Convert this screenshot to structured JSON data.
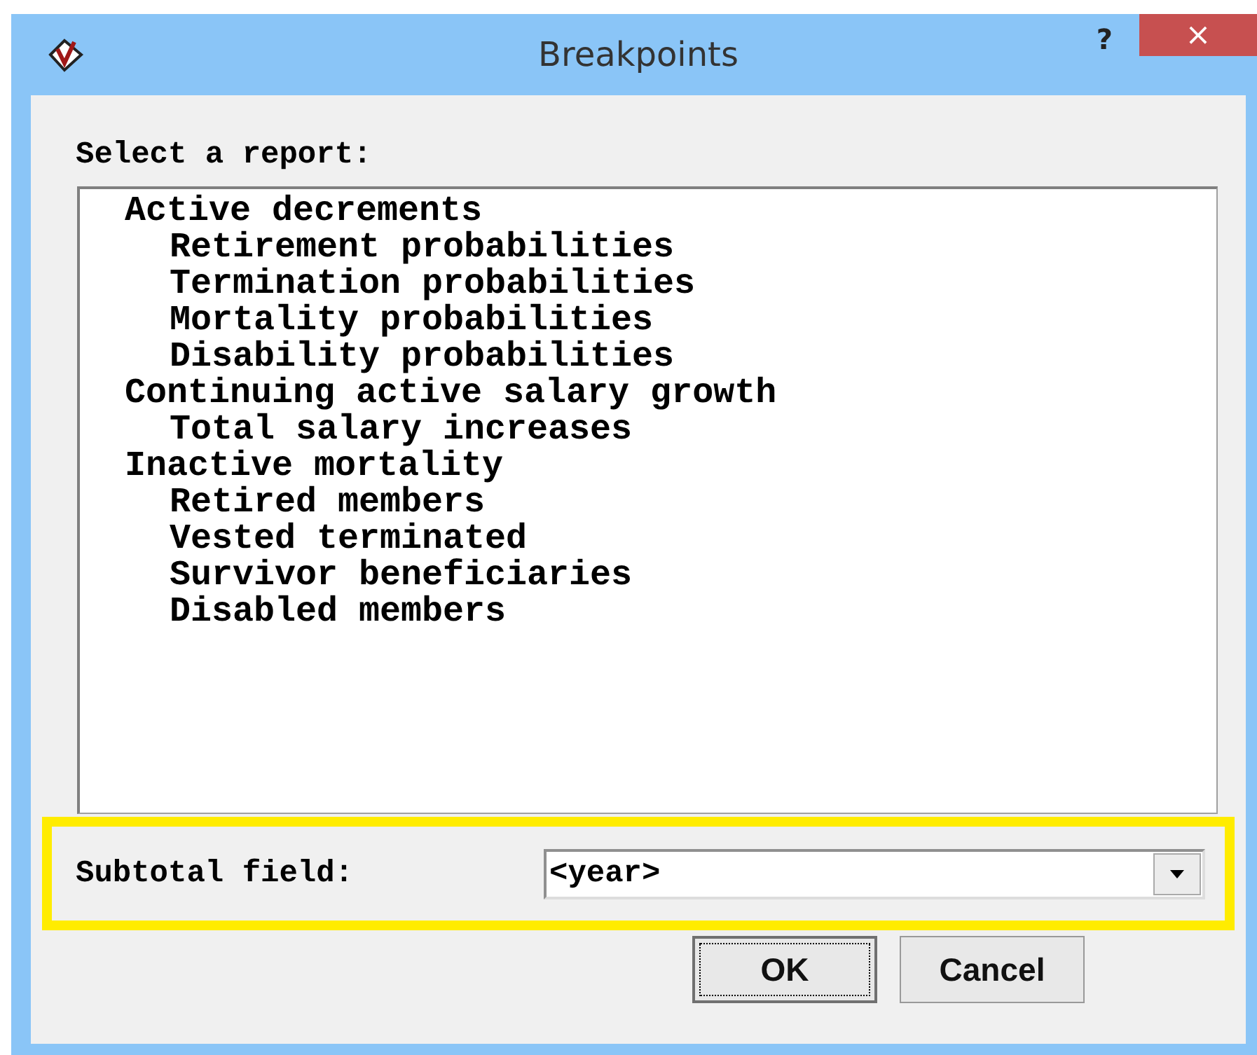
{
  "window": {
    "title": "Breakpoints",
    "help_button": "?",
    "close_button": "×"
  },
  "report_label": "Select a report:",
  "reports": [
    {
      "label": "Active decrements",
      "children": [
        {
          "label": "Retirement probabilities"
        },
        {
          "label": "Termination probabilities"
        },
        {
          "label": "Mortality probabilities"
        },
        {
          "label": "Disability probabilities"
        }
      ]
    },
    {
      "label": "Continuing active salary growth",
      "children": [
        {
          "label": "Total salary increases"
        }
      ]
    },
    {
      "label": "Inactive mortality",
      "children": [
        {
          "label": "Retired members"
        },
        {
          "label": "Vested terminated"
        },
        {
          "label": "Survivor beneficiaries"
        },
        {
          "label": "Disabled members"
        }
      ]
    }
  ],
  "subtotal": {
    "label": "Subtotal field:",
    "value": "<year>",
    "highlighted": true
  },
  "buttons": [
    {
      "label": "OK",
      "default": true
    },
    {
      "label": "Cancel",
      "default": false
    }
  ]
}
